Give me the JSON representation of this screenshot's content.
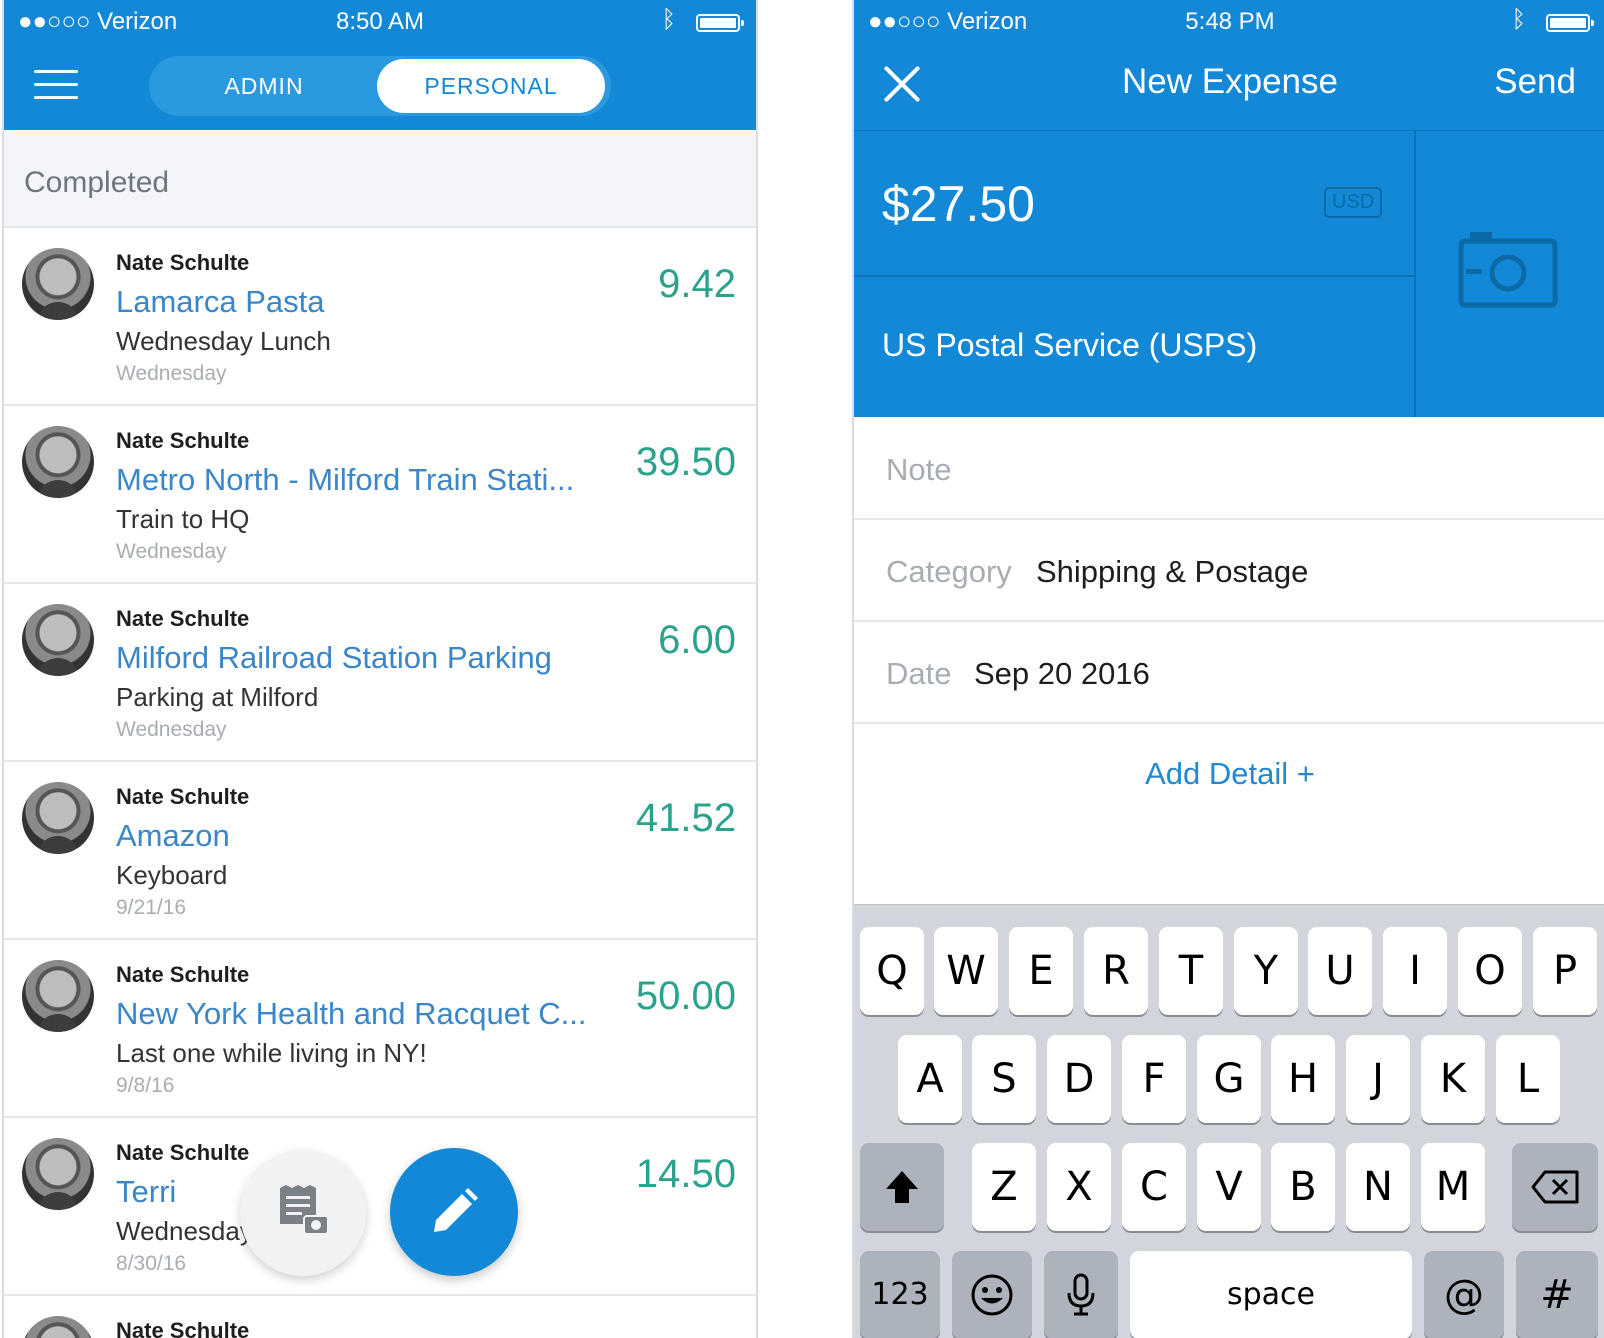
{
  "left": {
    "status": {
      "carrier": "●●○○○ Verizon",
      "time": "8:50 AM"
    },
    "tabs": {
      "admin": "ADMIN",
      "personal": "PERSONAL"
    },
    "section": "Completed",
    "rows": [
      {
        "name": "Nate Schulte",
        "merchant": "Lamarca Pasta",
        "desc": "Wednesday Lunch",
        "date": "Wednesday",
        "amount": "9.42"
      },
      {
        "name": "Nate Schulte",
        "merchant": "Metro North - Milford Train Stati...",
        "desc": "Train to HQ",
        "date": "Wednesday",
        "amount": "39.50"
      },
      {
        "name": "Nate Schulte",
        "merchant": "Milford Railroad Station Parking",
        "desc": "Parking at Milford",
        "date": "Wednesday",
        "amount": "6.00"
      },
      {
        "name": "Nate Schulte",
        "merchant": "Amazon",
        "desc": "Keyboard",
        "date": "9/21/16",
        "amount": "41.52"
      },
      {
        "name": "Nate Schulte",
        "merchant": "New York Health and Racquet C...",
        "desc": "Last one while living in NY!",
        "date": "9/8/16",
        "amount": "50.00"
      },
      {
        "name": "Nate Schulte",
        "merchant": "Terri",
        "desc": "Wednesday",
        "date": "8/30/16",
        "amount": "14.50"
      },
      {
        "name": "Nate Schulte"
      }
    ]
  },
  "right": {
    "status": {
      "carrier": "●●○○○ Verizon",
      "time": "5:48 PM"
    },
    "header": {
      "title": "New Expense",
      "send": "Send"
    },
    "amount": "$27.50",
    "currency": "USD",
    "merchant": "US Postal Service (USPS)",
    "note_label": "Note",
    "category_label": "Category",
    "category_value": "Shipping & Postage",
    "date_label": "Date",
    "date_value": "Sep 20 2016",
    "add_detail": "Add Detail +",
    "keyboard": {
      "row1": [
        "Q",
        "W",
        "E",
        "R",
        "T",
        "Y",
        "U",
        "I",
        "O",
        "P"
      ],
      "row2": [
        "A",
        "S",
        "D",
        "F",
        "G",
        "H",
        "J",
        "K",
        "L"
      ],
      "row3": [
        "Z",
        "X",
        "C",
        "V",
        "B",
        "N",
        "M"
      ],
      "numbers": "123",
      "space": "space",
      "at": "@",
      "hash": "#"
    }
  }
}
